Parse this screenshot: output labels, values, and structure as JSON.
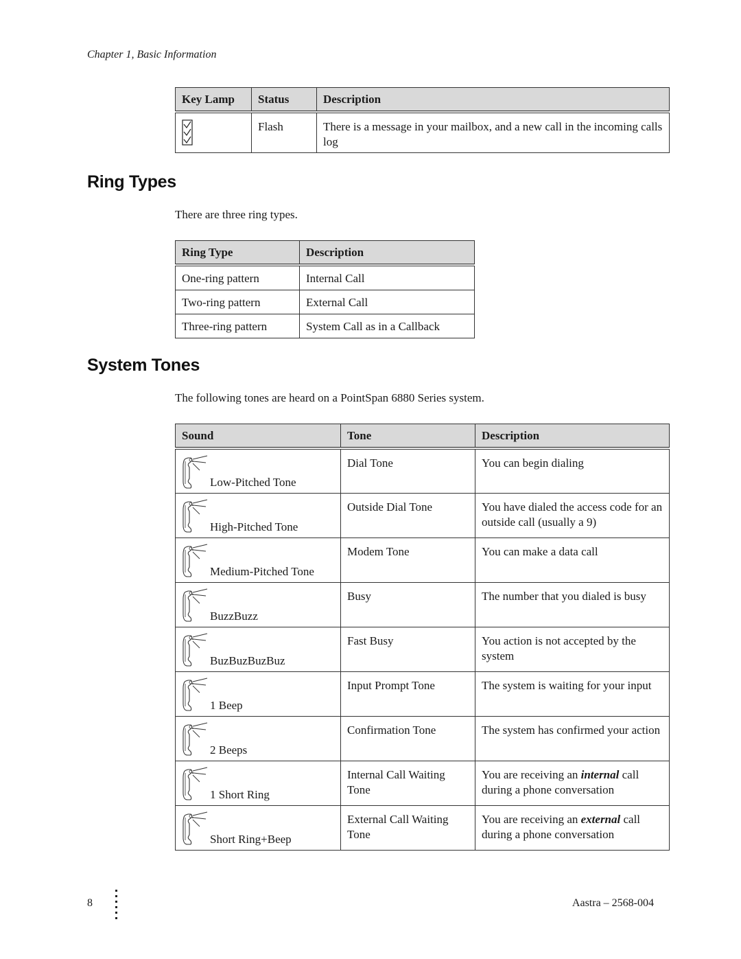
{
  "running_head": "Chapter 1, Basic Information",
  "key_lamp_table": {
    "headers": [
      "Key Lamp",
      "Status",
      "Description"
    ],
    "rows": [
      {
        "icon": "message-lamp-icon",
        "status": "Flash",
        "description": "There is a message in your mailbox, and a new call in the incoming calls log"
      }
    ]
  },
  "ring_types": {
    "heading": "Ring Types",
    "intro": "There are three ring types.",
    "headers": [
      "Ring Type",
      "Description"
    ],
    "rows": [
      {
        "type": "One-ring pattern",
        "description": "Internal Call"
      },
      {
        "type": "Two-ring pattern",
        "description": "External Call"
      },
      {
        "type": "Three-ring pattern",
        "description": "System Call as in a Callback"
      }
    ]
  },
  "system_tones": {
    "heading": "System Tones",
    "intro": "The following tones are heard on a PointSpan 6880 Series system.",
    "headers": [
      "Sound",
      "Tone",
      "Description"
    ],
    "rows": [
      {
        "icon": "handset-ringing-icon",
        "sound": "Low-Pitched Tone",
        "tone": "Dial Tone",
        "description": "You can begin dialing"
      },
      {
        "icon": "handset-ringing-icon",
        "sound": "High-Pitched Tone",
        "tone": "Outside Dial Tone",
        "description": "You have dialed the access code for an outside call (usually a 9)"
      },
      {
        "icon": "handset-ringing-icon",
        "sound": "Medium-Pitched Tone",
        "tone": "Modem Tone",
        "description": "You can make a data call"
      },
      {
        "icon": "handset-ringing-icon",
        "sound": "BuzzBuzz",
        "tone": "Busy",
        "description": "The number that you dialed is busy"
      },
      {
        "icon": "handset-ringing-icon",
        "sound": "BuzBuzBuzBuz",
        "tone": "Fast Busy",
        "description": "You action is not accepted by the system"
      },
      {
        "icon": "handset-ringing-icon",
        "sound": "1 Beep",
        "tone": "Input Prompt Tone",
        "description": "The system is waiting for your input"
      },
      {
        "icon": "handset-ringing-icon",
        "sound": "2 Beeps",
        "tone": "Confirmation Tone",
        "description": "The system has confirmed your action"
      },
      {
        "icon": "handset-ringing-icon",
        "sound": "1 Short Ring",
        "tone": "Internal Call Waiting Tone",
        "description_pre": "You are receiving an ",
        "description_em": "internal",
        "description_post": " call during a phone conversation"
      },
      {
        "icon": "handset-ringing-icon",
        "sound": "Short Ring+Beep",
        "tone": "External Call Waiting Tone",
        "description_pre": "You are receiving an ",
        "description_em": "external",
        "description_post": " call during a phone conversation"
      }
    ]
  },
  "footer": {
    "page_number": "8",
    "doc_id": "Aastra – 2568-004"
  }
}
